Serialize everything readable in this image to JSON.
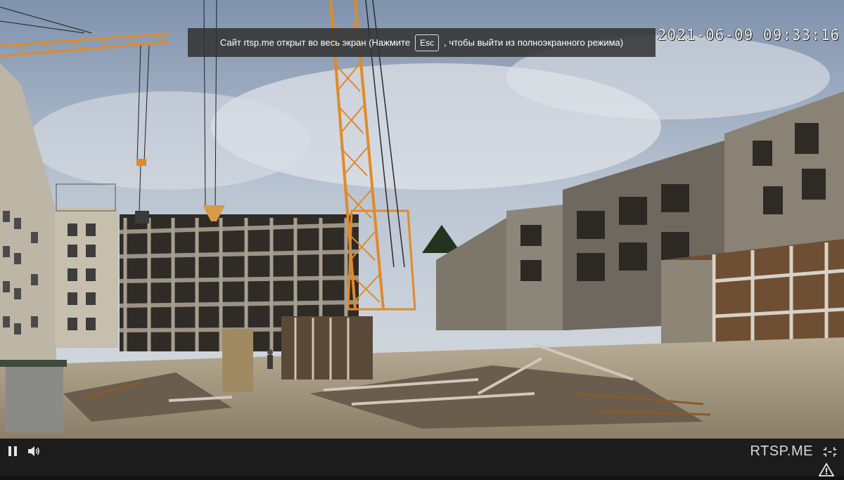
{
  "overlay": {
    "timestamp": "2021-06-09 09:33:16",
    "fullscreen_notice": {
      "prefix": "Сайт rtsp.me открыт во весь экран (Нажмите",
      "key": "Esc",
      "suffix": ", чтобы выйти из полноэкранного режима)"
    }
  },
  "controls": {
    "pause_icon": "pause-icon",
    "volume_icon": "volume-icon",
    "brand": "RTSP.ME",
    "fullscreen_icon": "exit-fullscreen-icon",
    "warning_icon": "warning-icon"
  },
  "colors": {
    "crane": "#e08a2a",
    "sky": "#9eb0c6",
    "concrete": "#8f8a80",
    "control_bar": "#1c1c1c"
  }
}
